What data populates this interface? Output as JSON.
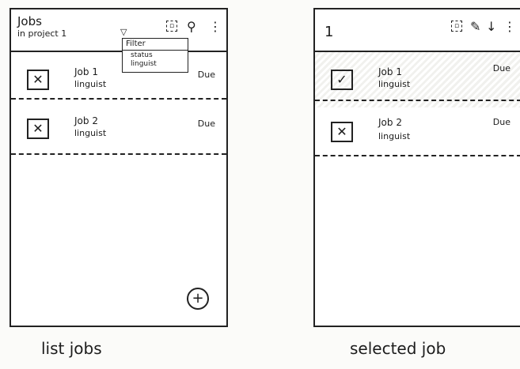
{
  "screen_list": {
    "header": {
      "title": "Jobs",
      "subtitle": "in project 1",
      "caret": "▽"
    },
    "icons": {
      "select": "select-all-icon",
      "search": "search-icon",
      "more": "more-vertical-icon"
    },
    "filter_menu": {
      "title": "Filter",
      "options": [
        "status",
        "linguist"
      ]
    },
    "items": [
      {
        "title": "Job 1",
        "subtitle": "linguist",
        "due": "Due"
      },
      {
        "title": "Job 2",
        "subtitle": "linguist",
        "due": "Due"
      }
    ],
    "fab_label": "+",
    "caption": "list jobs"
  },
  "screen_selected": {
    "header": {
      "count": "1"
    },
    "icons": {
      "select": "select-all-icon",
      "edit": "edit-icon",
      "download": "download-icon",
      "more": "more-vertical-icon"
    },
    "items": [
      {
        "title": "Job 1",
        "subtitle": "linguist",
        "due": "Due",
        "checked": true
      },
      {
        "title": "Job 2",
        "subtitle": "linguist",
        "due": "Due",
        "checked": false
      }
    ],
    "caption": "selected job"
  }
}
